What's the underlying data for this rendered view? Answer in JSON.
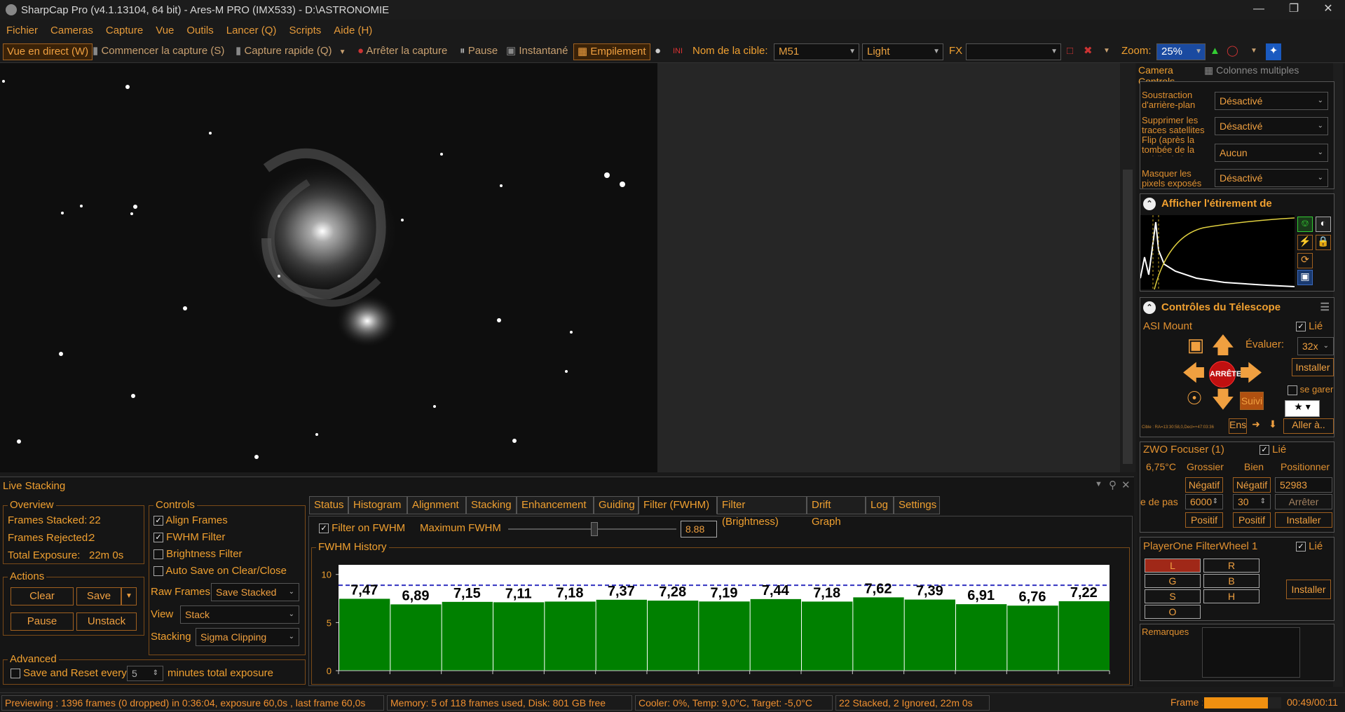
{
  "title": "SharpCap Pro (v4.1.13104, 64 bit) - Ares-M PRO (IMX533) - D:\\ASTRONOMIE",
  "menu": [
    "Fichier",
    "Cameras",
    "Capture",
    "Vue",
    "Outils",
    "Lancer (Q)",
    "Scripts",
    "Aide (H)"
  ],
  "toolbar": {
    "live": "Vue en direct (W)",
    "start_capture": "Commencer la capture (S)",
    "quick_capture": "Capture rapide (Q)",
    "stop_capture": "Arrêter la capture",
    "pause": "Pause",
    "snapshot": "Instantané",
    "stacking": "Empilement",
    "target_label": "Nom de la cible:",
    "target_value": "M51",
    "frame_type": "Light",
    "fx_label": "FX",
    "zoom_label": "Zoom:",
    "zoom_value": "25%"
  },
  "camera_controls": {
    "title": "Camera Controls",
    "columns": "Colonnes multiples",
    "rows": [
      {
        "label": "Soustraction d'arrière-plan",
        "value": "Désactivé"
      },
      {
        "label": "Supprimer les traces satellites",
        "value": "Désactivé"
      },
      {
        "label": "Flip (après la tombée de la nuit/à plat)",
        "value": "Aucun"
      },
      {
        "label": "Masquer les pixels exposés",
        "value": "Désactivé"
      }
    ]
  },
  "histogram": {
    "title": "Afficher l'étirement de l'histogramme"
  },
  "telescope": {
    "title": "Contrôles du Télescope",
    "mount": "ASI Mount",
    "linked": "Lié",
    "rate_label": "Évaluer:",
    "rate_value": "32x",
    "install": "Installer",
    "stop": "ARRÊTE",
    "park": "se garer",
    "track": "Suivi",
    "set": "Ens",
    "goto": "Aller à..",
    "coords": "Cible : RA=13:30:58,0,Decl=+47:03:36"
  },
  "focuser": {
    "title": "ZWO Focuser (1)",
    "linked": "Lié",
    "temp": "6,75°C",
    "coarse": "Grossier",
    "fine": "Bien",
    "position": "Positionner",
    "neg1": "Négatif",
    "neg2": "Négatif",
    "pos_value": "52983",
    "step_label": "e de pas",
    "coarse_step": "6000",
    "fine_step": "30",
    "stop": "Arrêter",
    "pos1": "Positif",
    "pos2": "Positif",
    "install": "Installer"
  },
  "filterwheel": {
    "title": "PlayerOne FilterWheel 1",
    "linked": "Lié",
    "filters": [
      "L",
      "R",
      "G",
      "B",
      "S",
      "H",
      "O"
    ],
    "install": "Installer"
  },
  "notes": {
    "label": "Remarques"
  },
  "live_stacking": {
    "title": "Live Stacking",
    "overview": {
      "title": "Overview",
      "stacked_label": "Frames Stacked:",
      "stacked": "22",
      "rejected_label": "Frames Rejected:",
      "rejected": "2",
      "exposure_label": "Total Exposure:",
      "exposure": "22m 0s"
    },
    "actions": {
      "title": "Actions",
      "clear": "Clear",
      "save": "Save",
      "pause": "Pause",
      "unstack": "Unstack"
    },
    "advanced": {
      "title": "Advanced",
      "save_reset": "Save and Reset every",
      "minutes": "5",
      "minutes_label": "minutes total exposure"
    },
    "controls": {
      "title": "Controls",
      "align": "Align Frames",
      "fwhm": "FWHM Filter",
      "brightness": "Brightness Filter",
      "autosave": "Auto Save on Clear/Close",
      "raw_label": "Raw Frames",
      "raw_value": "Save Stacked",
      "view_label": "View",
      "view_value": "Stack",
      "stacking_label": "Stacking",
      "stacking_value": "Sigma Clipping"
    },
    "tabs": [
      "Status",
      "Histogram",
      "Alignment",
      "Stacking",
      "Enhancement",
      "Guiding",
      "Filter (FWHM)",
      "Filter (Brightness)",
      "Drift Graph",
      "Log",
      "Settings"
    ],
    "fwhm": {
      "filter_label": "Filter on FWHM",
      "max_label": "Maximum FWHM",
      "max_value": "8.88",
      "history": "FWHM History"
    }
  },
  "chart_data": {
    "type": "bar",
    "title": "FWHM History",
    "values": [
      7.47,
      6.89,
      7.15,
      7.11,
      7.18,
      7.37,
      7.28,
      7.19,
      7.44,
      7.18,
      7.62,
      7.39,
      6.91,
      6.76,
      7.22
    ],
    "labels": [
      "7,47",
      "6,89",
      "7,15",
      "7,11",
      "7,18",
      "7,37",
      "7,28",
      "7,19",
      "7,44",
      "7,18",
      "7,62",
      "7,39",
      "6,91",
      "6,76",
      "7,22"
    ],
    "ylim": [
      0,
      11
    ],
    "yticks": [
      "0",
      "5",
      "10"
    ],
    "threshold": 8.88,
    "bar_color": "#008000",
    "threshold_color": "#3030c0"
  },
  "status": {
    "preview": "Previewing : 1396 frames (0 dropped) in 0:36:04, exposure 60,0s , last frame 60,0s",
    "memory": "Memory: 5 of 118 frames used, Disk: 801 GB free",
    "cooler": "Cooler: 0%, Temp: 9,0°C, Target: -5,0°C",
    "stack": "22 Stacked, 2 Ignored, 22m 0s",
    "frame_label": "Frame :",
    "frame_time": "00:49/00:11"
  },
  "colors": {
    "accent": "#f0a030",
    "bg": "#151515"
  }
}
